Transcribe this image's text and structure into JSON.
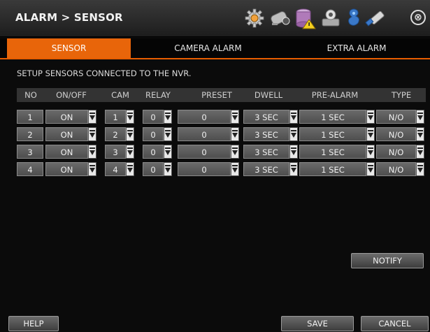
{
  "header": {
    "title": "ALARM > SENSOR",
    "icons": [
      "settings-gear-icon",
      "camera-icon",
      "storage-warning-icon",
      "network-icon",
      "user-icon",
      "usb-icon"
    ],
    "close_label": "⊗"
  },
  "tabs": [
    {
      "label": "SENSOR",
      "active": true
    },
    {
      "label": "CAMERA ALARM",
      "active": false
    },
    {
      "label": "EXTRA ALARM",
      "active": false
    }
  ],
  "description": "SETUP SENSORS CONNECTED TO THE NVR.",
  "table": {
    "headers": [
      "NO",
      "ON/OFF",
      "CAM",
      "RELAY",
      "PRESET",
      "DWELL",
      "PRE-ALARM",
      "TYPE"
    ],
    "rows": [
      {
        "no": "1",
        "onoff": "ON",
        "cam": "1",
        "relay": "0",
        "preset": "0",
        "dwell": "3 SEC",
        "prealarm": "1 SEC",
        "type": "N/O"
      },
      {
        "no": "2",
        "onoff": "ON",
        "cam": "2",
        "relay": "0",
        "preset": "0",
        "dwell": "3 SEC",
        "prealarm": "1 SEC",
        "type": "N/O"
      },
      {
        "no": "3",
        "onoff": "ON",
        "cam": "3",
        "relay": "0",
        "preset": "0",
        "dwell": "3 SEC",
        "prealarm": "1 SEC",
        "type": "N/O"
      },
      {
        "no": "4",
        "onoff": "ON",
        "cam": "4",
        "relay": "0",
        "preset": "0",
        "dwell": "3 SEC",
        "prealarm": "1 SEC",
        "type": "N/O"
      }
    ]
  },
  "buttons": {
    "notify": "NOTIFY",
    "help": "HELP",
    "save": "SAVE",
    "cancel": "CANCEL"
  },
  "colors": {
    "accent": "#e8650a",
    "background": "#0b0b0b"
  }
}
